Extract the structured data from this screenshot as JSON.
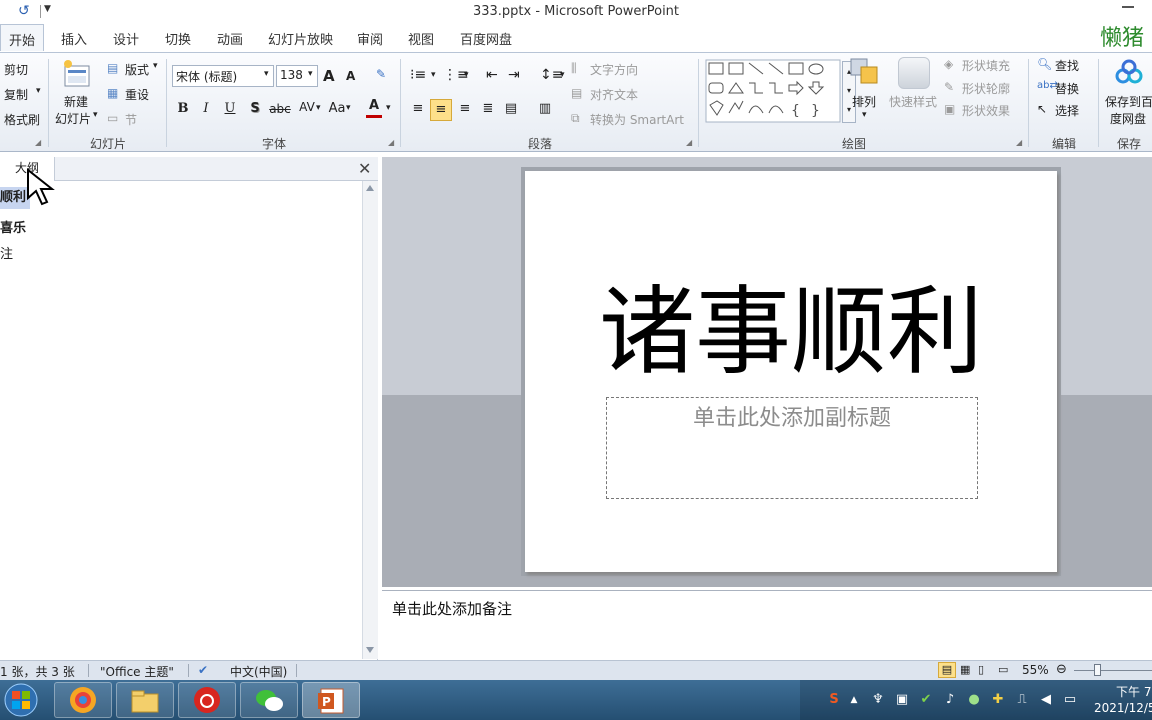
{
  "window": {
    "title": "333.pptx  -  Microsoft PowerPoint",
    "brand": "懒猪"
  },
  "tabs": [
    "开始",
    "插入",
    "设计",
    "切换",
    "动画",
    "幻灯片放映",
    "审阅",
    "视图",
    "百度网盘"
  ],
  "ribbon": {
    "clipboard": {
      "cut": "剪切",
      "copy": "复制",
      "format_painter": "格式刷"
    },
    "slides": {
      "new_slide_1": "新建",
      "new_slide_2": "幻灯片",
      "layout": "版式",
      "reset": "重设",
      "section": "节",
      "group": "幻灯片"
    },
    "font": {
      "font_name": "宋体 (标题)",
      "font_size": "138",
      "bold": "B",
      "italic": "I",
      "underline": "U",
      "shadow": "S",
      "strike": "abc",
      "spacing": "AV",
      "case": "Aa",
      "font_color": "A",
      "grow": "A",
      "shrink": "A",
      "group": "字体"
    },
    "paragraph": {
      "text_direction": "文字方向",
      "align_text": "对齐文本",
      "smartart": "转换为 SmartArt",
      "group": "段落"
    },
    "drawing": {
      "arrange": "排列",
      "quick_styles": "快速样式",
      "shape_fill": "形状填充",
      "shape_outline": "形状轮廓",
      "shape_effects": "形状效果",
      "group": "绘图"
    },
    "editing": {
      "find": "查找",
      "replace": "替换",
      "select": "选择",
      "group": "编辑"
    },
    "save": {
      "label_1": "保存到百",
      "label_2": "度网盘",
      "group": "保存"
    }
  },
  "outline": {
    "tab": "大纲",
    "items": [
      "顺利",
      "喜乐",
      "注"
    ]
  },
  "slide": {
    "title": "诸事顺利",
    "subtitle_placeholder": "单击此处添加副标题"
  },
  "notes": {
    "placeholder": "单击此处添加备注"
  },
  "status": {
    "slide_count": "1 张，共 3 张",
    "theme": "\"Office 主题\"",
    "language": "中文(中国)",
    "zoom": "55%"
  },
  "clock": {
    "time": "下午 7",
    "date": "2021/12/5"
  }
}
